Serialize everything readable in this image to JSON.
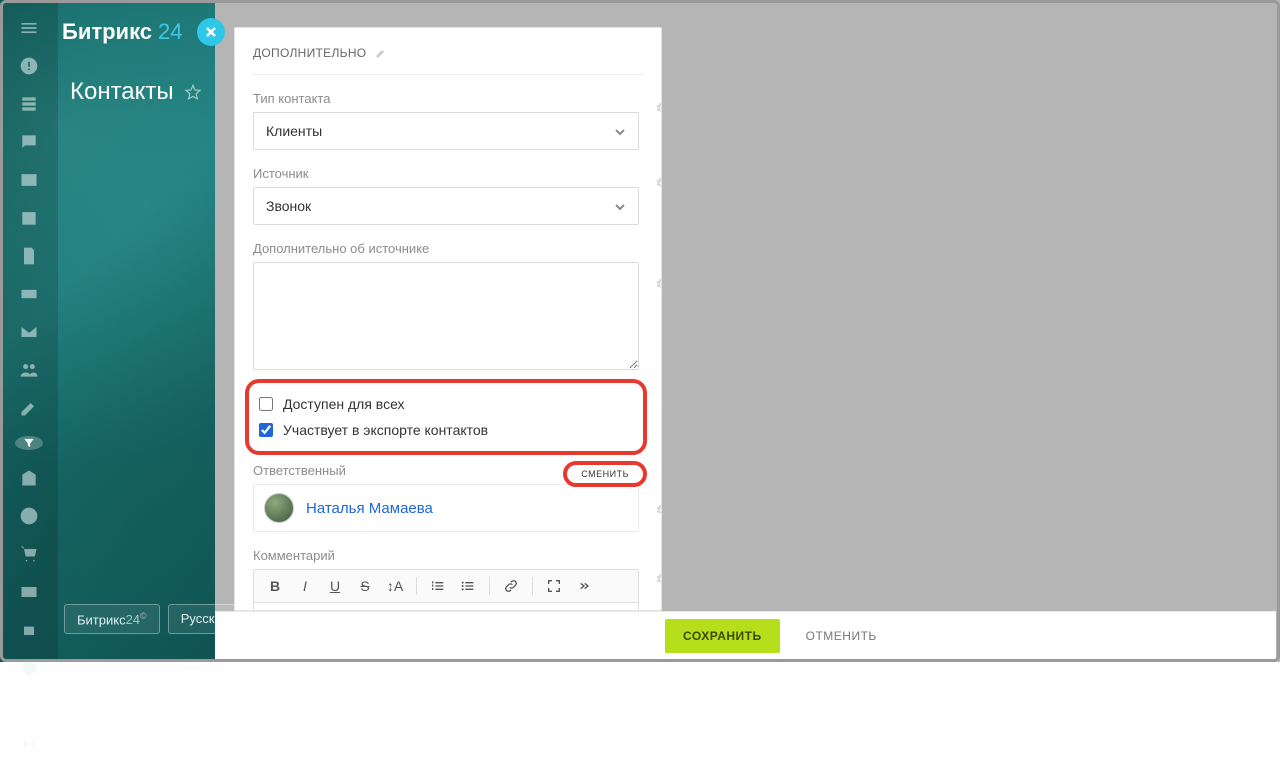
{
  "brand": {
    "name": "Битрикс",
    "suffix": "24",
    "badge_name": "Битрикс",
    "badge_suffix": "24",
    "lang": "Русски"
  },
  "page": {
    "title": "Контакты"
  },
  "section": {
    "title": "ДОПОЛНИТЕЛЬНО"
  },
  "fields": {
    "contact_type": {
      "label": "Тип контакта",
      "value": "Клиенты"
    },
    "source": {
      "label": "Источник",
      "value": "Звонок"
    },
    "source_extra": {
      "label": "Дополнительно об источнике",
      "value": ""
    },
    "available_all": {
      "label": "Доступен для всех",
      "checked": false
    },
    "in_export": {
      "label": "Участвует в экспорте контактов",
      "checked": true
    },
    "responsible": {
      "label": "Ответственный",
      "swap": "СМЕНИТЬ",
      "person": "Наталья Мамаева"
    },
    "comment": {
      "label": "Комментарий"
    }
  },
  "actions": {
    "save": "СОХРАНИТЬ",
    "cancel": "ОТМЕНИТЬ"
  }
}
